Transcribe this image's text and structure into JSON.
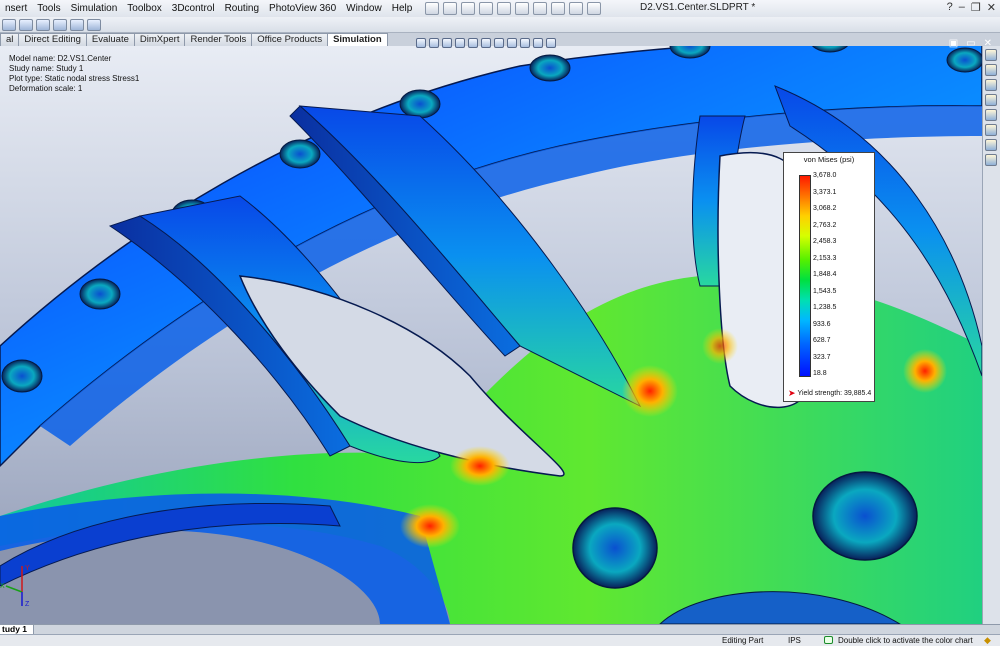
{
  "menubar": {
    "items": [
      "nsert",
      "Tools",
      "Simulation",
      "Toolbox",
      "3Dcontrol",
      "Routing",
      "PhotoView 360",
      "Window",
      "Help"
    ],
    "document_title": "D2.VS1.Center.SLDPRT *",
    "window_controls": [
      "?",
      "–",
      "❐",
      "✕"
    ]
  },
  "tabs": [
    {
      "label": "al",
      "active": false
    },
    {
      "label": "Direct Editing",
      "active": false
    },
    {
      "label": "Evaluate",
      "active": false
    },
    {
      "label": "DimXpert",
      "active": false
    },
    {
      "label": "Render Tools",
      "active": false
    },
    {
      "label": "Office Products",
      "active": false
    },
    {
      "label": "Simulation",
      "active": true
    }
  ],
  "study_info": {
    "model_name": "Model name: D2.VS1.Center",
    "study_name": "Study name: Study 1",
    "plot_type": "Plot type: Static nodal stress Stress1",
    "deformation_scale": "Deformation scale: 1"
  },
  "viewport_controls": [
    "▣",
    "▭",
    "✕"
  ],
  "legend": {
    "title": "von Mises (psi)",
    "ticks": [
      "3,678.0",
      "3,373.1",
      "3,068.2",
      "2,763.2",
      "2,458.3",
      "2,153.3",
      "1,848.4",
      "1,543.5",
      "1,238.5",
      "933.6",
      "628.7",
      "323.7",
      "18.8"
    ],
    "yield": "Yield strength: 39,885.4",
    "colors": {
      "max": "#ff1a00",
      "high": "#ffd000",
      "mid": "#00e040",
      "low": "#00b8ff",
      "min": "#0010ff"
    }
  },
  "study_tabs": [
    "tudy 1"
  ],
  "status": {
    "mode": "Editing Part",
    "units": "IPS",
    "hint": "Double click to activate the color chart"
  },
  "axes": {
    "x": "X",
    "y": "Y",
    "z": "Z"
  }
}
